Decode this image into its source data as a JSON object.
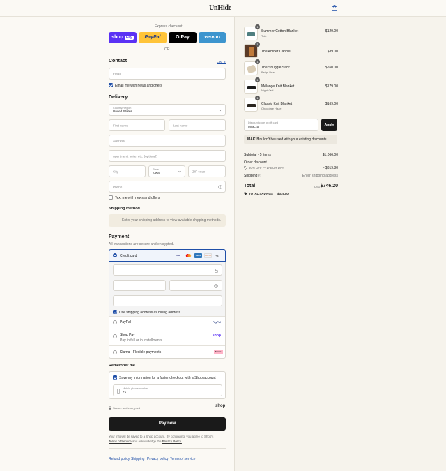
{
  "header": {
    "brand": "UnHide"
  },
  "express": {
    "title": "Express checkout",
    "or": "OR",
    "buttons": {
      "shop": "shop",
      "shop_pay": "Pay",
      "paypal": "PayPal",
      "gpay": "G Pay",
      "venmo": "venmo"
    }
  },
  "contact": {
    "title": "Contact",
    "login": "Log in",
    "email_placeholder": "Email",
    "news_label": "Email me with news and offers"
  },
  "delivery": {
    "title": "Delivery",
    "country_label": "Country/Region",
    "country_value": "United States",
    "first_name": "First name",
    "last_name": "Last name",
    "address": "Address",
    "apartment": "Apartment, suite, etc. (optional)",
    "city": "City",
    "state_label": "State",
    "state_value": "Iowa",
    "zip": "ZIP code",
    "phone": "Phone",
    "text_label": "Text me with news and offers"
  },
  "shipping_method": {
    "title": "Shipping method",
    "notice": "Enter your shipping address to view available shipping methods."
  },
  "payment": {
    "title": "Payment",
    "subtitle": "All transactions are secure and encrypted.",
    "credit_card": "Credit card",
    "card_more": "+4",
    "card_logos": {
      "visa": "VISA",
      "amex": "AMEX",
      "discover": "DISCOVER"
    },
    "billing_same": "Use shipping address as billing address",
    "paypal": "PayPal",
    "paypal_logo": "PayPal",
    "shop_pay": "Shop Pay",
    "shop_pay_sub": "Pay in full or in installments",
    "shop_logo": "shop",
    "klarna": "Klarna - Flexible payments",
    "klarna_logo": "Klarna."
  },
  "remember": {
    "title": "Remember me",
    "save_label": "Save my information for a faster checkout with a Shop account",
    "phone_label": "Mobile phone number",
    "phone_value": "+1",
    "secure": "Secure and encrypted",
    "shop_logo": "shop"
  },
  "pay_button": "Pay now",
  "disclaimer": {
    "line1": "Your info will be saved to a Shop account. By continuing, you agree to Shop's",
    "tos": "Terms of Service",
    "and": "and acknowledge the",
    "privacy": "Privacy Policy."
  },
  "footer_links": [
    "Refund policy",
    "Shipping",
    "Privacy policy",
    "Terms of service"
  ],
  "cart": {
    "items": [
      {
        "qty": "1",
        "name": "Summer Cotton Blanket",
        "variant": "Tide",
        "price": "$129.00"
      },
      {
        "qty": "1",
        "name": "The Amber Candle",
        "variant": "",
        "price": "$39.00"
      },
      {
        "qty": "1",
        "name": "The Snuggle Sack",
        "variant": "Beige Bear",
        "price": "$550.00"
      },
      {
        "qty": "1",
        "name": "Mélange Knit Blanket",
        "variant": "Night Owl",
        "price": "$179.00"
      },
      {
        "qty": "1",
        "name": "Classic Knit Blanket",
        "variant": "Chocolate Haze",
        "price": "$169.00"
      }
    ],
    "discount_label": "Discount code or gift card",
    "discount_value": "MAK15",
    "apply": "Apply",
    "error_code": "MAK15",
    "error_text": "couldn't be used with your existing discounts.",
    "subtotal_label": "Subtotal · 5 items",
    "subtotal_value": "$1,066.00",
    "order_discount": "Order discount",
    "discount_name": "30% OFF — LABOR DAY",
    "discount_amount": "- $319.80",
    "shipping_label": "Shipping",
    "shipping_value": "Enter shipping address",
    "total_label": "Total",
    "currency": "USD",
    "total_value": "$746.20",
    "savings_label": "TOTAL SAVINGS",
    "savings_value": "$319.80"
  }
}
